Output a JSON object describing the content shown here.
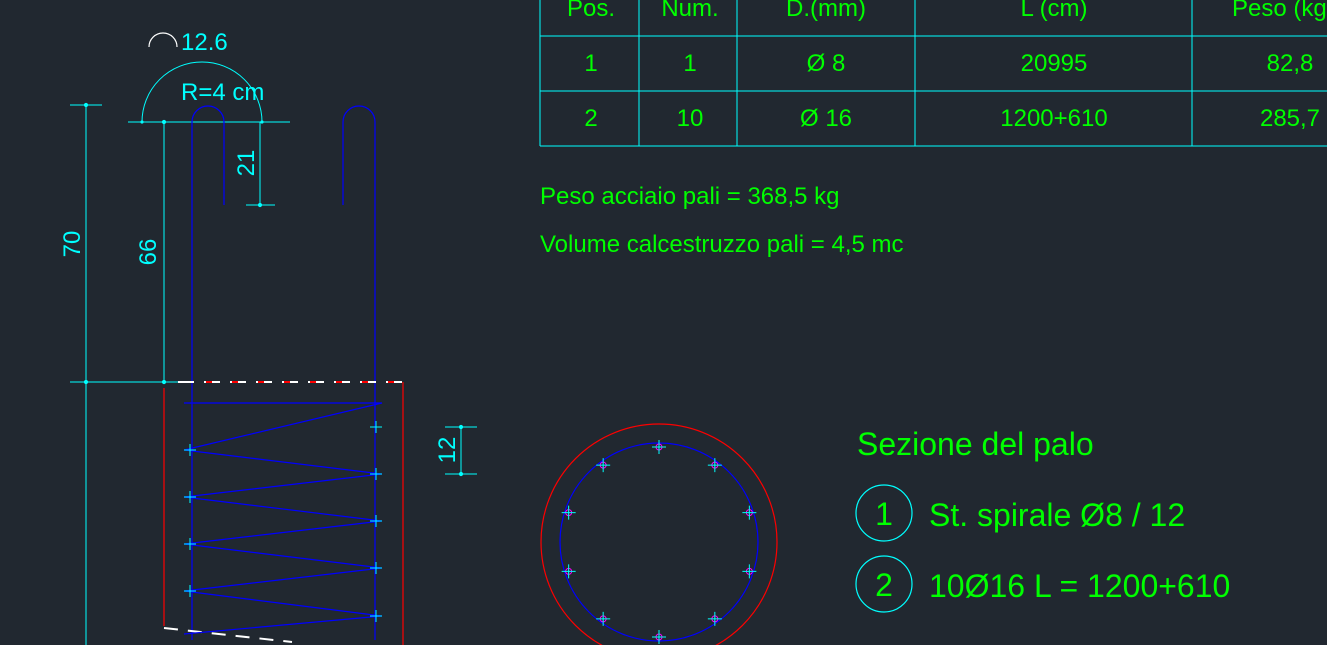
{
  "table": {
    "headers": [
      "Pos.",
      "Num.",
      "D.(mm)",
      "L (cm)",
      "Peso (kg"
    ],
    "rows": [
      [
        "1",
        "1",
        "Ø 8",
        "20995",
        "82,8"
      ],
      [
        "2",
        "10",
        "Ø 16",
        "1200+610",
        "285,7"
      ]
    ]
  },
  "notes": {
    "weight": "Peso acciaio pali = 368,5 kg",
    "volume": "Volume calcestruzzo pali = 4,5 mc"
  },
  "dimensions": {
    "hook_length": "12.6",
    "radius": "R=4 cm",
    "d21": "21",
    "d70": "70",
    "d66": "66",
    "pitch": "12"
  },
  "section": {
    "title": "Sezione del palo",
    "item1_num": "1",
    "item1_text": "St. spirale Ø8 / 12",
    "item2_num": "2",
    "item2_text": "10Ø16  L = 1200+610",
    "bar_count": 10
  },
  "colors": {
    "background": "#212830",
    "green": "#00ff00",
    "cyan": "#00ffff",
    "blue": "#0000ff",
    "red": "#ff0000",
    "white": "#ffffff"
  }
}
